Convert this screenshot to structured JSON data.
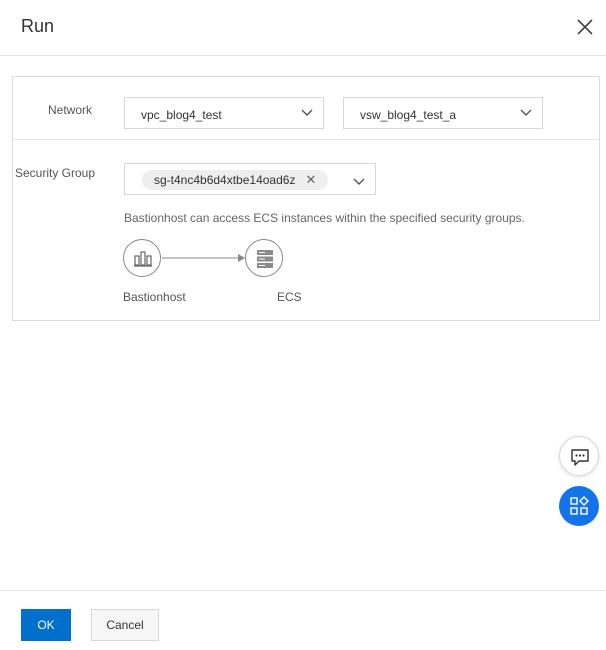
{
  "dialog": {
    "title": "Run",
    "close_icon": "close-icon"
  },
  "form": {
    "network": {
      "label": "Network",
      "vpc_value": "vpc_blog4_test",
      "vswitch_value": "vsw_blog4_test_a"
    },
    "security_group": {
      "label": "Security Group",
      "selected_tag": "sg-t4nc4b6d4xtbe14oad6z",
      "tag_remove_glyph": "✕",
      "help_text": "Bastionhost can access ECS instances within the specified security groups."
    },
    "diagram": {
      "source_label": "Bastionhost",
      "target_label": "ECS",
      "source_icon": "bastionhost-icon",
      "target_icon": "server-icon"
    }
  },
  "floating": {
    "feedback_icon": "chat-icon",
    "apps_icon": "apps-icon",
    "apps_color": "#1473ea"
  },
  "footer": {
    "ok_label": "OK",
    "cancel_label": "Cancel"
  },
  "colors": {
    "primary": "#0070cc",
    "border": "#d7d7d7"
  }
}
